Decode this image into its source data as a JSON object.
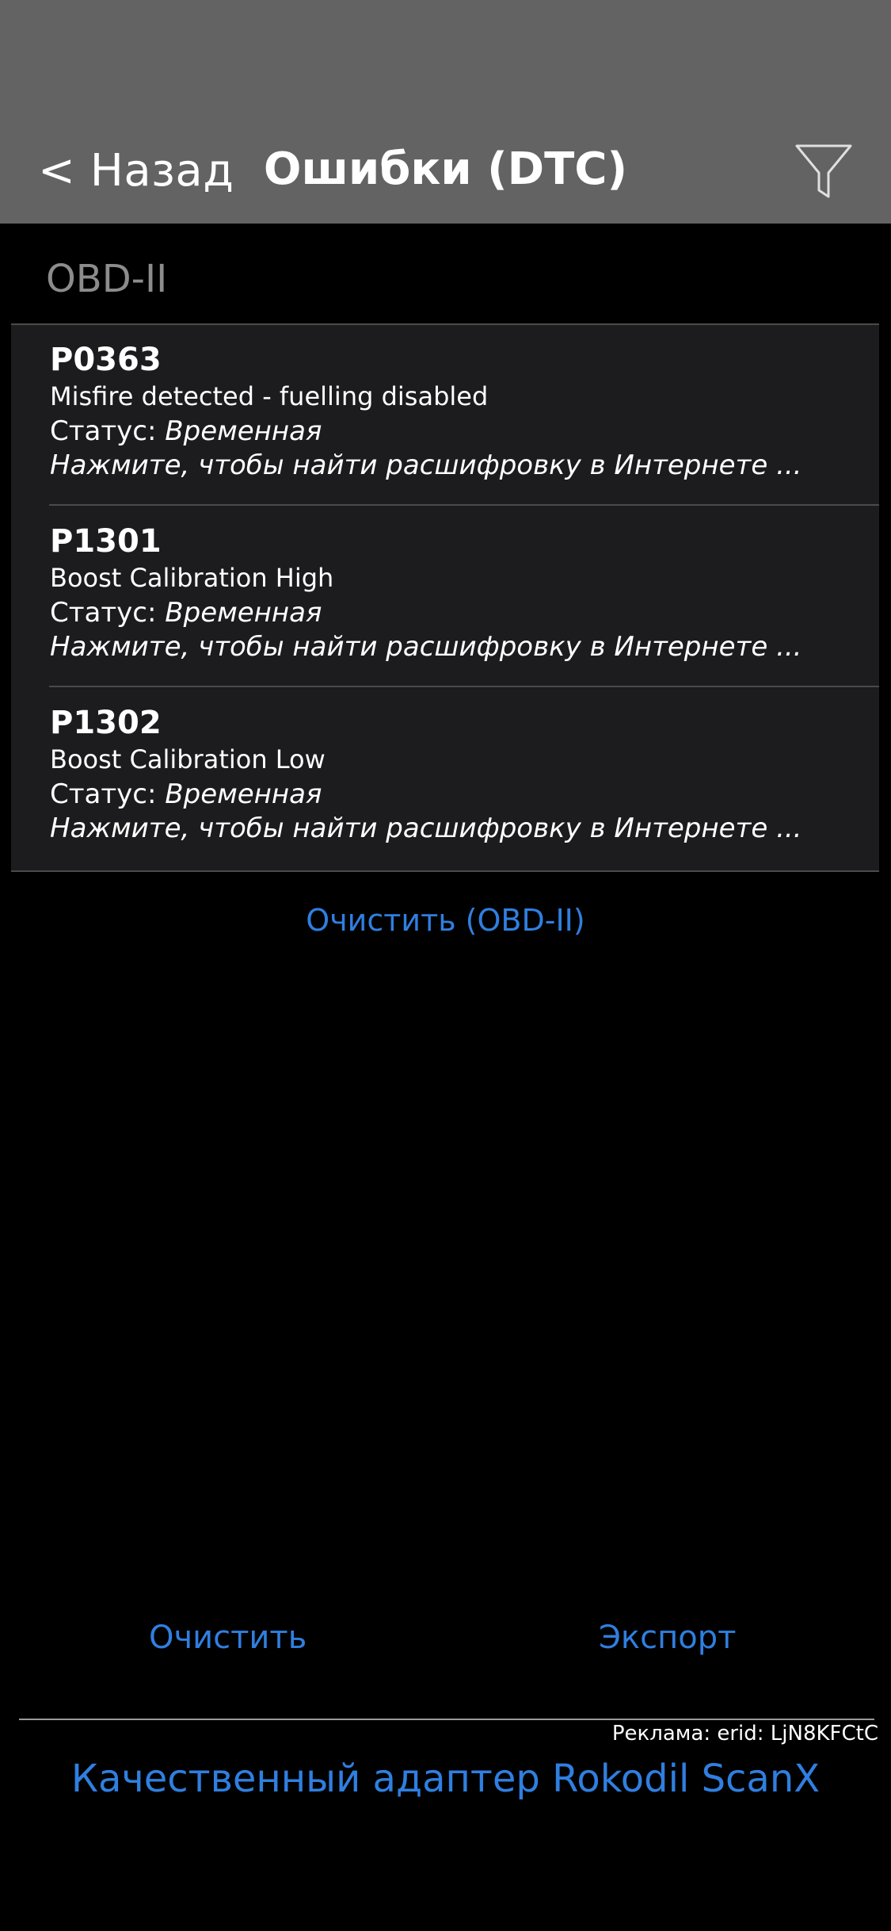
{
  "header": {
    "back_label": "< Назад",
    "title": "Ошибки (DTC)",
    "filter_icon": "funnel-icon"
  },
  "section": {
    "title": "OBD-II"
  },
  "dtc_list": [
    {
      "code": "P0363",
      "description": "Misfire detected - fuelling disabled",
      "status_label": "Статус:",
      "status_value": "Временная",
      "hint": "Нажмите, чтобы найти расшифровку в Интернете ..."
    },
    {
      "code": "P1301",
      "description": "Boost Calibration High",
      "status_label": "Статус:",
      "status_value": "Временная",
      "hint": "Нажмите, чтобы найти расшифровку в Интернете ..."
    },
    {
      "code": "P1302",
      "description": "Boost Calibration Low",
      "status_label": "Статус:",
      "status_value": "Временная",
      "hint": "Нажмите, чтобы найти расшифровку в Интернете ..."
    }
  ],
  "clear_obd_label": "Очистить (OBD-II)",
  "toolbar": {
    "clear_label": "Очистить",
    "export_label": "Экспорт"
  },
  "ad": {
    "label": "Реклама: erid: LjN8KFCtC",
    "link_text": "Качественный адаптер Rokodil ScanX"
  },
  "colors": {
    "header_bg": "#636363",
    "list_bg": "#1c1c1e",
    "accent": "#2f7fe0",
    "background": "#000000"
  }
}
